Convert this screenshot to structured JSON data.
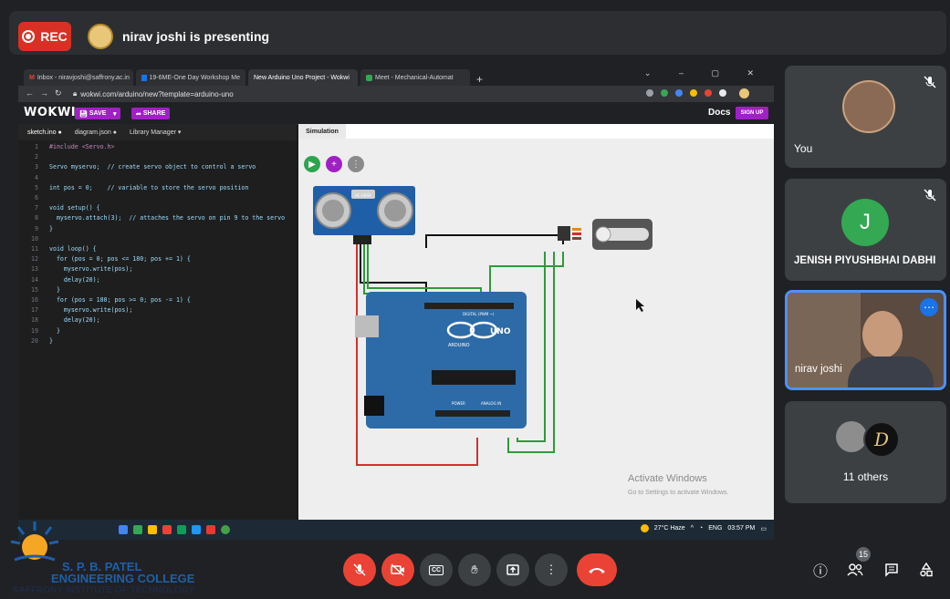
{
  "meet": {
    "rec_label": "REC",
    "presenting_text": "nirav joshi is presenting",
    "participants": [
      {
        "name": "You"
      },
      {
        "name": "JENISH PIYUSHBHAI DABHI",
        "initial": "J"
      },
      {
        "name": "nirav joshi"
      },
      {
        "name": "11 others"
      }
    ],
    "people_count": "15",
    "colors": {
      "rec": "#d93025",
      "end_call": "#ea4335",
      "tile": "#3c4043",
      "initial_avatar": "#34a853",
      "active_border": "#4d90fe"
    }
  },
  "browser": {
    "tabs": [
      {
        "label": "Inbox - niravjoshi@saffrony.ac.in"
      },
      {
        "label": "19-6ME-One Day Workshop Me"
      },
      {
        "label": "New Arduino Uno Project - Wokwi"
      },
      {
        "label": "Meet - Mechanical-Automat"
      }
    ],
    "new_tab": "+",
    "url": "wokwi.com/arduino/new?template=arduino-uno"
  },
  "wokwi": {
    "logo": "WOKWI",
    "save": "SAVE",
    "share": "SHARE",
    "docs": "Docs",
    "signup": "SIGN UP",
    "editor_tabs": [
      "sketch.ino ●",
      "diagram.json ●",
      "Library Manager ▾"
    ],
    "simulation_tab": "Simulation",
    "code_lines": [
      "#include <Servo.h>",
      "",
      "Servo myservo;  // create servo object to control a servo",
      "",
      "int pos = 0;    // variable to store the servo position",
      "",
      "void setup() {",
      "  myservo.attach(3);  // attaches the servo on pin 9 to the servo",
      "}",
      "",
      "void loop() {",
      "  for (pos = 0; pos <= 180; pos += 1) {",
      "    myservo.write(pos);",
      "    delay(20);",
      "  }",
      "  for (pos = 180; pos >= 0; pos -= 1) {",
      "    myservo.write(pos);",
      "    delay(20);",
      "  }",
      "}"
    ],
    "board_label": "UNO",
    "board_brand": "ARDUINO",
    "digital_label": "DIGITAL (PWM ~)",
    "analog_label": "ANALOG IN",
    "power_label": "POWER",
    "sensor_label": "HC-SR04"
  },
  "windows": {
    "activate_title": "Activate Windows",
    "activate_sub": "Go to Settings to activate Windows.",
    "weather": "27°C Haze",
    "lang": "ENG",
    "time": "03:57 PM"
  },
  "college": {
    "line1": "S. P. B. PATEL",
    "line2": "ENGINEERING COLLEGE",
    "line3": "SAFFRONY INSTITUTE OF TECHNOLOGY"
  }
}
